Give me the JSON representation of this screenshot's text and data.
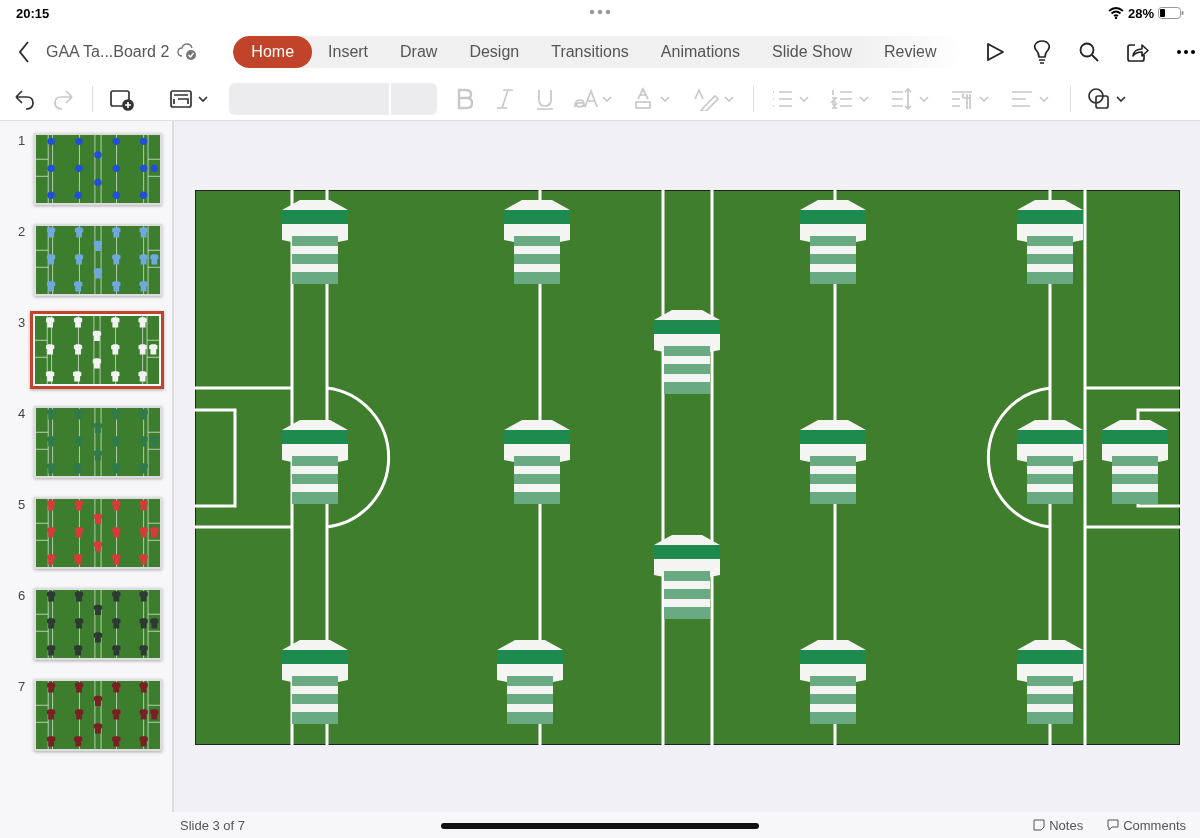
{
  "status_bar": {
    "time": "20:15",
    "battery": "28%"
  },
  "document": {
    "title": "GAA Ta...Board 2"
  },
  "tabs": [
    {
      "label": "Home",
      "selected": true
    },
    {
      "label": "Insert",
      "selected": false
    },
    {
      "label": "Draw",
      "selected": false
    },
    {
      "label": "Design",
      "selected": false
    },
    {
      "label": "Transitions",
      "selected": false
    },
    {
      "label": "Animations",
      "selected": false
    },
    {
      "label": "Slide Show",
      "selected": false
    },
    {
      "label": "Review",
      "selected": false
    }
  ],
  "toolbar": [
    {
      "kind": "undo",
      "disabled": false
    },
    {
      "kind": "redo",
      "disabled": true
    },
    {
      "kind": "new-slide",
      "disabled": false
    },
    {
      "kind": "layout",
      "disabled": false
    },
    {
      "kind": "bold",
      "disabled": true
    },
    {
      "kind": "italic",
      "disabled": true
    },
    {
      "kind": "underline",
      "disabled": true
    },
    {
      "kind": "size",
      "disabled": true
    },
    {
      "kind": "color",
      "disabled": true
    },
    {
      "kind": "highlight",
      "disabled": true
    },
    {
      "kind": "bullets",
      "disabled": true
    },
    {
      "kind": "numbers",
      "disabled": true
    },
    {
      "kind": "spacing",
      "disabled": true
    },
    {
      "kind": "paragraph",
      "disabled": true
    },
    {
      "kind": "align",
      "disabled": true
    },
    {
      "kind": "shapes",
      "disabled": false
    }
  ],
  "slides": [
    {
      "number": "1",
      "selected": false,
      "kind": "discs",
      "color": "#2150d6"
    },
    {
      "number": "2",
      "selected": false,
      "kind": "shirts",
      "color": "#6fa8dc"
    },
    {
      "number": "3",
      "selected": true,
      "kind": "shirts",
      "color": "#f2f2f2"
    },
    {
      "number": "4",
      "selected": false,
      "kind": "shirts",
      "color": "#2f7a4a"
    },
    {
      "number": "5",
      "selected": false,
      "kind": "shirts",
      "color": "#d63a3a"
    },
    {
      "number": "6",
      "selected": false,
      "kind": "shirts",
      "color": "#2d3a33"
    },
    {
      "number": "7",
      "selected": false,
      "kind": "shirts",
      "color": "#7a1f24"
    }
  ],
  "footer": {
    "slide_indicator": "Slide 3 of 7",
    "notes": "Notes",
    "comments": "Comments"
  }
}
